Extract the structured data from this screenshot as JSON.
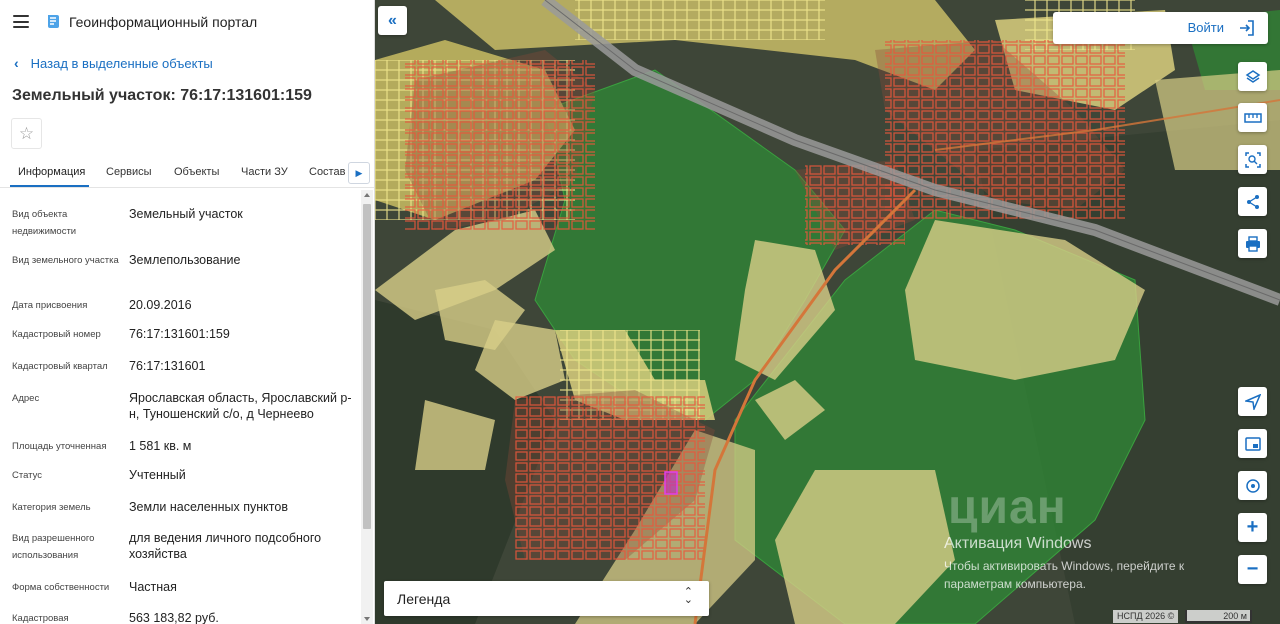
{
  "header": {
    "portal_title": "Геоинформационный портал"
  },
  "nav": {
    "back_label": "Назад в выделенные объекты"
  },
  "object": {
    "title": "Земельный участок: 76:17:131601:159"
  },
  "tabs": [
    {
      "label": "Информация"
    },
    {
      "label": "Сервисы"
    },
    {
      "label": "Объекты"
    },
    {
      "label": "Части ЗУ"
    },
    {
      "label": "Состав"
    }
  ],
  "properties": [
    {
      "label": "Вид объекта недвижимости",
      "value": "Земельный участок"
    },
    {
      "label": "Вид земельного участка",
      "value": "Землепользование"
    },
    {
      "label": "Дата присвоения",
      "value": "20.09.2016"
    },
    {
      "label": "Кадастровый номер",
      "value": "76:17:131601:159"
    },
    {
      "label": "Кадастровый квартал",
      "value": "76:17:131601"
    },
    {
      "label": "Адрес",
      "value": "Ярославская область, Ярославский р-н, Туношенский с/о, д Чернеево"
    },
    {
      "label": "Площадь уточненная",
      "value": "1 581 кв. м"
    },
    {
      "label": "Статус",
      "value": "Учтенный"
    },
    {
      "label": "Категория земель",
      "value": "Земли населенных пунктов"
    },
    {
      "label": "Вид разрешенного использования",
      "value": "для ведения личного подсобного хозяйства"
    },
    {
      "label": "Форма собственности",
      "value": "Частная"
    },
    {
      "label": "Кадастровая",
      "value": "563 183,82 руб."
    }
  ],
  "map": {
    "login_label": "Войти",
    "legend_label": "Легенда",
    "attribution": "НСПД 2026 ©",
    "scale_label": "200 м",
    "icons": [
      "layers-icon",
      "ruler-icon",
      "select-area-icon",
      "share-icon",
      "print-icon",
      "locate-icon",
      "minimap-icon",
      "geolocation-icon"
    ]
  },
  "watermark": {
    "logo_text": "циан",
    "title": "Активация Windows",
    "subtitle": "Чтобы активировать Windows, перейдите к параметрам компьютера."
  },
  "colors": {
    "accent": "#1a6fc2",
    "parcel_yellow": "#e3d98a",
    "parcel_red": "#e05a3a",
    "forest_green": "#2f8a35"
  }
}
